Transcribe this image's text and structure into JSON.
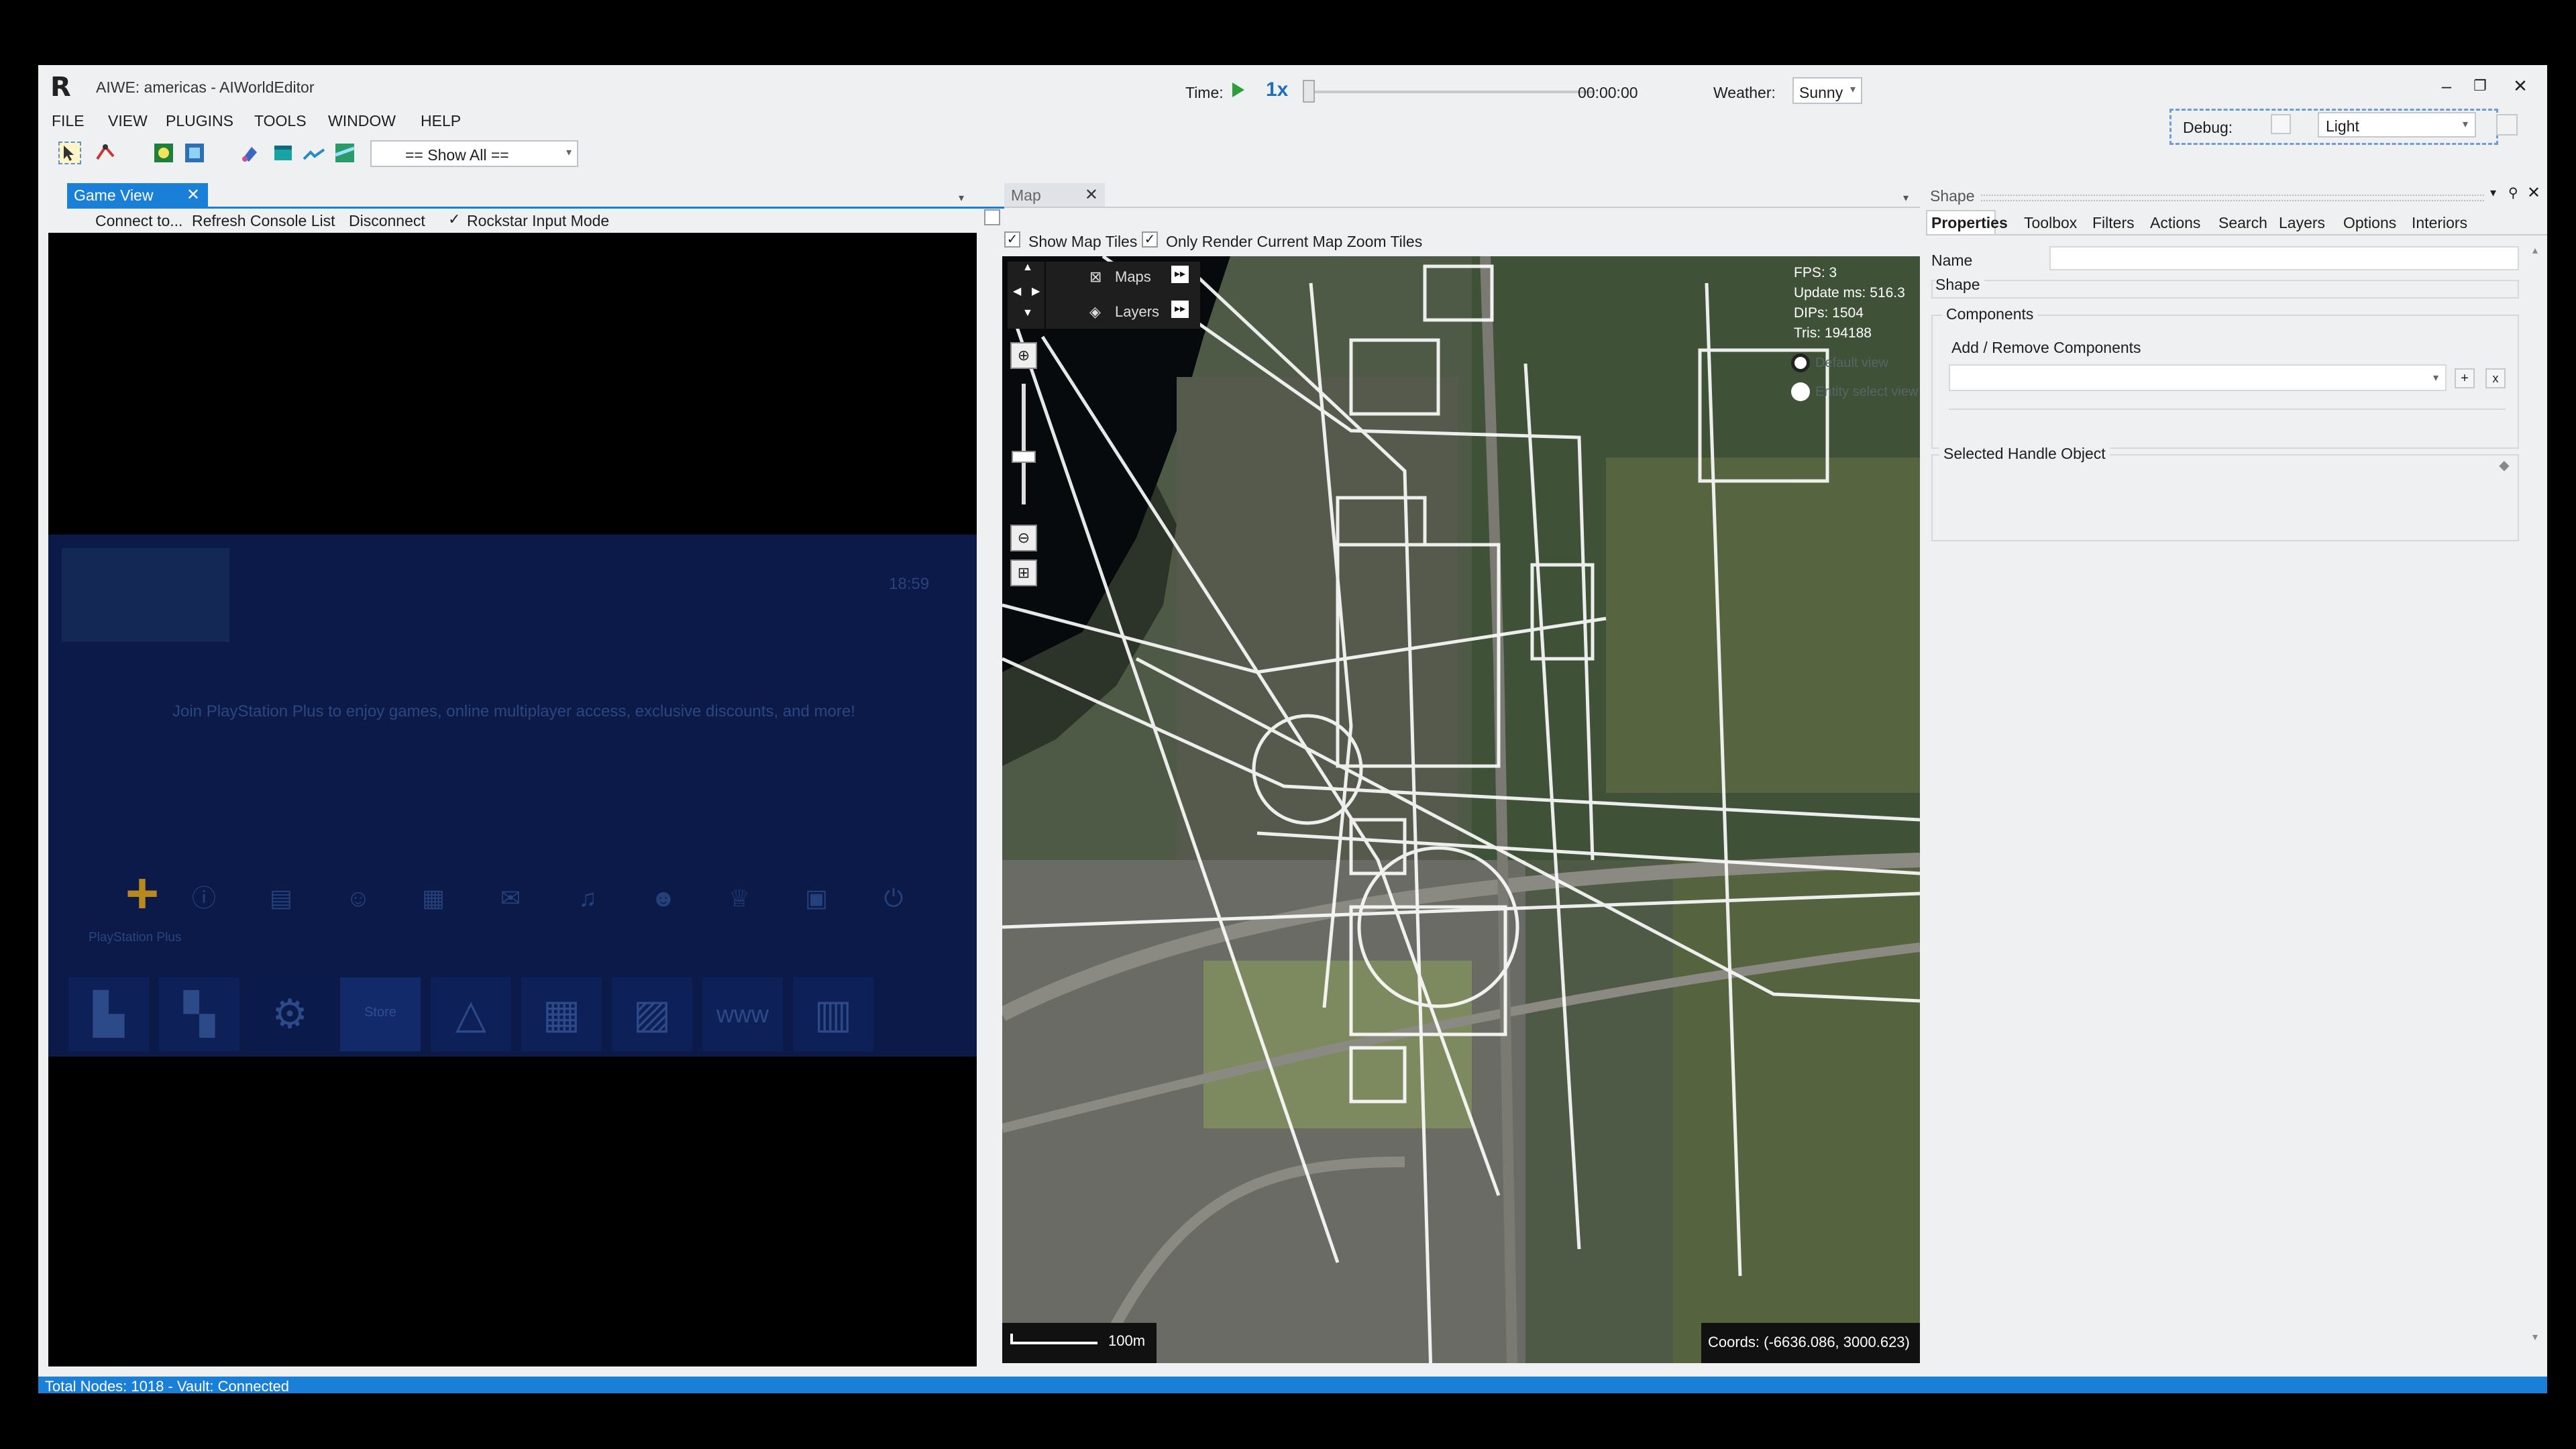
{
  "window": {
    "title": "AIWE: americas - AIWorldEditor",
    "logo": "R"
  },
  "time": {
    "label": "Time:",
    "speed": "1x",
    "value": "00:00:00"
  },
  "weather": {
    "label": "Weather:",
    "selected": "Sunny"
  },
  "debug": {
    "label": "Debug:",
    "theme": "Light"
  },
  "menu": [
    "FILE",
    "VIEW",
    "PLUGINS",
    "TOOLS",
    "WINDOW",
    "HELP"
  ],
  "toolbar": {
    "filter": "== Show All =="
  },
  "game_view": {
    "tab": "Game View",
    "actions": [
      "Connect to...",
      "Refresh Console List",
      "Disconnect",
      "Rockstar Input Mode"
    ],
    "rockstar_input_checked": true,
    "clock": "18:59",
    "message": "Join PlayStation Plus to enjoy games, online multiplayer access, exclusive discounts, and more!",
    "plus_label": "PlayStation Plus",
    "store_label": "Store"
  },
  "map": {
    "tab": "Map",
    "show_tiles": "Show Map Tiles",
    "only_render": "Only Render Current Map Zoom Tiles",
    "maps_label": "Maps",
    "layers_label": "Layers",
    "fps": "FPS: 3",
    "update_ms": "Update ms: 516.3",
    "dips": "DIPs: 1504",
    "tris": "Tris: 194188",
    "default_view": "Default view",
    "entity_view": "Entity select view",
    "scale": "100m",
    "coords": "Coords: (-6636.086, 3000.623)"
  },
  "shape_panel": {
    "title": "Shape",
    "tabs": [
      "Properties",
      "Toolbox",
      "Filters",
      "Actions",
      "Search",
      "Layers",
      "Options",
      "Interiors"
    ],
    "name_label": "Name",
    "name_value": "",
    "shape_label": "Shape",
    "components_label": "Components",
    "add_remove": "Add / Remove Components",
    "selected_handle": "Selected Handle Object"
  },
  "status": {
    "text": "Total Nodes: 1018 - Vault: Connected"
  },
  "colors": {
    "accent": "#1a7fd6",
    "play": "#2e9e3b",
    "ps_band": "#0c1a4a"
  }
}
